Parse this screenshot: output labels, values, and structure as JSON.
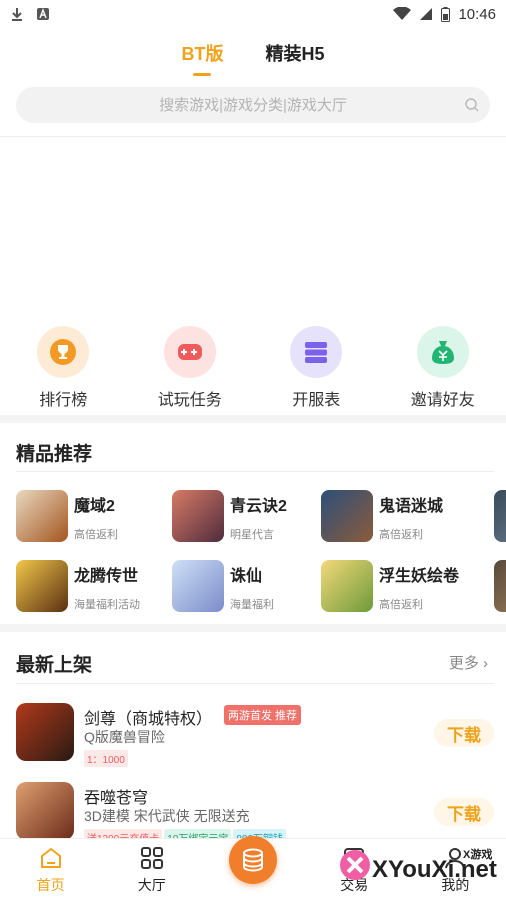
{
  "status_bar": {
    "time": "10:46"
  },
  "tabs": [
    {
      "label": "BT版",
      "active": true
    },
    {
      "label": "精装H5",
      "active": false
    }
  ],
  "search": {
    "placeholder": "搜索游戏|游戏分类|游戏大厅"
  },
  "quick_links": [
    {
      "label": "排行榜",
      "icon": "trophy-icon",
      "bg": "#fdebd6",
      "fg": "#f39a25"
    },
    {
      "label": "试玩任务",
      "icon": "gamepad-icon",
      "bg": "#fde2e2",
      "fg": "#f05b5b"
    },
    {
      "label": "开服表",
      "icon": "server-icon",
      "bg": "#e6e2fb",
      "fg": "#7a63e8"
    },
    {
      "label": "邀请好友",
      "icon": "money-bag-icon",
      "bg": "#dcf5ea",
      "fg": "#22b573"
    }
  ],
  "featured": {
    "title": "精品推荐",
    "items": [
      {
        "name": "魔域2",
        "tag": "高倍返利",
        "color1": "#e9d9c0",
        "color2": "#a4541f"
      },
      {
        "name": "青云诀2",
        "tag": "明星代言",
        "color1": "#d87a66",
        "color2": "#4f2c3d"
      },
      {
        "name": "鬼语迷城",
        "tag": "高倍返利",
        "color1": "#2c4f7a",
        "color2": "#8b5b3a"
      },
      {
        "name": "龙腾传世",
        "tag": "海量福利活动",
        "color1": "#f2c74a",
        "color2": "#5a2f12"
      },
      {
        "name": "诛仙",
        "tag": "海量福利",
        "color1": "#cfe0f7",
        "color2": "#7a8cc9"
      },
      {
        "name": "浮生妖绘卷",
        "tag": "高倍返利",
        "color1": "#f3d97a",
        "color2": "#6e9a3a"
      }
    ]
  },
  "latest": {
    "title": "最新上架",
    "more_label": "更多",
    "items": [
      {
        "name": "剑尊（商城特权）",
        "badge": "两游首发 推荐",
        "desc": "Q版魔兽冒险",
        "tags": [
          {
            "text": "1：1000",
            "style": "red"
          }
        ],
        "download_label": "下载",
        "color1": "#b23a1c",
        "color2": "#2a1a12"
      },
      {
        "name": "吞噬苍穹",
        "badge": "",
        "desc": "3D建模 宋代武侠 无限送充",
        "tags": [
          {
            "text": "送1200元充值卡",
            "style": "red"
          },
          {
            "text": "10万绑定元宝",
            "style": "green"
          },
          {
            "text": "800万铜钱",
            "style": "cyan"
          }
        ],
        "download_label": "下载",
        "color1": "#e0a070",
        "color2": "#6a2a1a"
      }
    ]
  },
  "bottom_nav": [
    {
      "label": "首页",
      "icon": "home-icon",
      "active": true
    },
    {
      "label": "大厅",
      "icon": "grid-icon",
      "active": false
    },
    {
      "label": "",
      "icon": "coin-stack-icon",
      "active": false
    },
    {
      "label": "交易",
      "icon": "trade-icon",
      "active": false
    },
    {
      "label": "我的",
      "icon": "user-icon",
      "active": false
    }
  ],
  "watermark": {
    "text": "XYouXi.net",
    "small": "X游戏"
  },
  "colors": {
    "accent": "#f0a31a",
    "center_button": "#f07e2a"
  }
}
